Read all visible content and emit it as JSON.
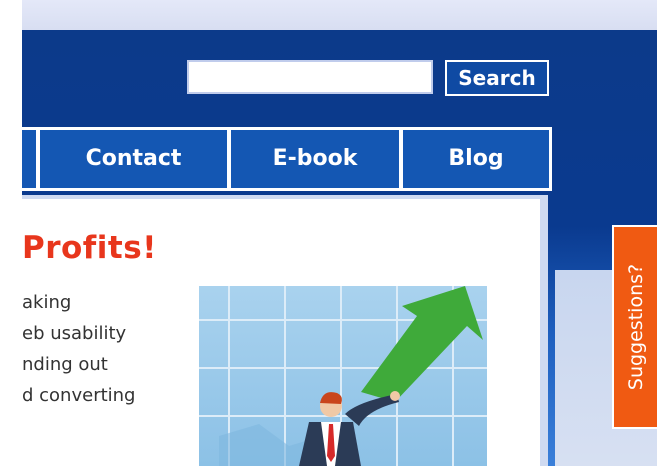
{
  "search": {
    "input_value": "",
    "button_label": "Search"
  },
  "nav": {
    "items": [
      {
        "label": "Contact"
      },
      {
        "label": "E-book"
      },
      {
        "label": "Blog"
      }
    ]
  },
  "content": {
    "headline": "Profits!",
    "paragraph_lines": [
      "aking",
      "eb usability",
      "nding out",
      "d converting"
    ]
  },
  "suggestions": {
    "label": "Suggestions?"
  },
  "colors": {
    "header_blue": "#0c3a8a",
    "nav_blue": "#1457b3",
    "headline_red": "#e8361c",
    "suggest_orange": "#f05a12",
    "arrow_green": "#3faa3a"
  }
}
